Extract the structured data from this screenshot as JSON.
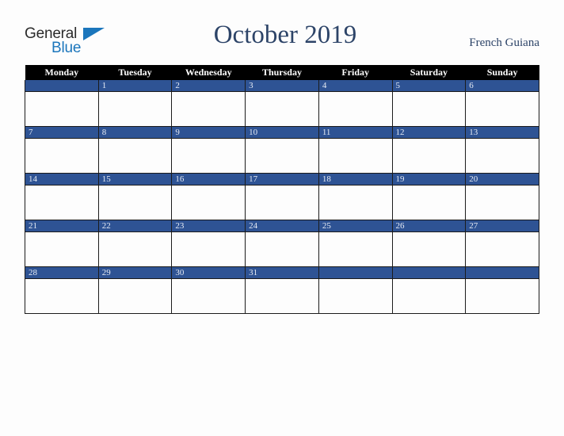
{
  "brand": {
    "word_one": "General",
    "word_two": "Blue",
    "triangle_icon": "triangle-icon",
    "color_dark": "#2b2b2b",
    "color_blue": "#1b76bc"
  },
  "header": {
    "title": "October 2019",
    "country": "French Guiana",
    "title_color": "#2d4468"
  },
  "calendar": {
    "month": "October",
    "year": "2019",
    "locale": "French Guiana",
    "accent_color": "#2e5394",
    "header_bg": "#000000",
    "weekday_headers": [
      "Monday",
      "Tuesday",
      "Wednesday",
      "Thursday",
      "Friday",
      "Saturday",
      "Sunday"
    ],
    "weeks": [
      [
        "",
        "1",
        "2",
        "3",
        "4",
        "5",
        "6"
      ],
      [
        "7",
        "8",
        "9",
        "10",
        "11",
        "12",
        "13"
      ],
      [
        "14",
        "15",
        "16",
        "17",
        "18",
        "19",
        "20"
      ],
      [
        "21",
        "22",
        "23",
        "24",
        "25",
        "26",
        "27"
      ],
      [
        "28",
        "29",
        "30",
        "31",
        "",
        "",
        ""
      ]
    ]
  }
}
